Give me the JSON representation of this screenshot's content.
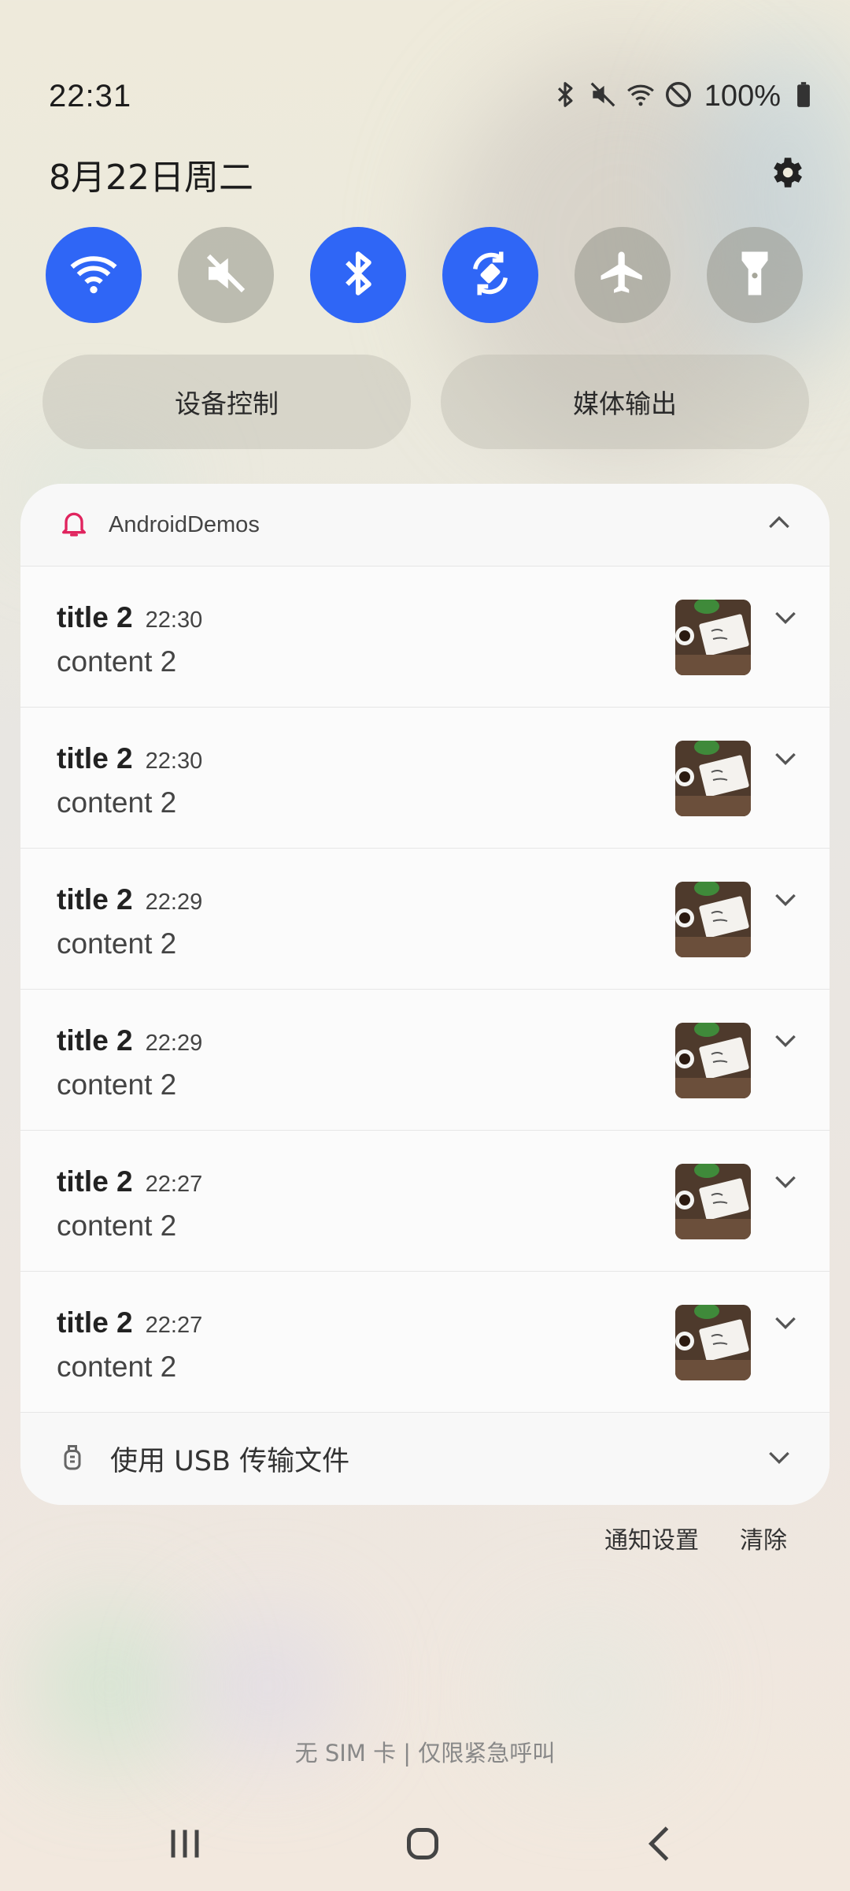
{
  "status_bar": {
    "time": "22:31",
    "battery": "100%",
    "icons": [
      "bluetooth-icon",
      "mute-icon",
      "wifi-icon",
      "do-not-disturb-icon",
      "battery-icon"
    ]
  },
  "header": {
    "date": "8月22日周二",
    "settings_icon": "gear-icon"
  },
  "quick_settings": [
    {
      "name": "wifi",
      "icon": "wifi-icon",
      "state": "on"
    },
    {
      "name": "sound",
      "icon": "mute-icon",
      "state": "off"
    },
    {
      "name": "bluetooth",
      "icon": "bluetooth-icon",
      "state": "on"
    },
    {
      "name": "auto-rotate",
      "icon": "rotate-icon",
      "state": "on"
    },
    {
      "name": "airplane",
      "icon": "airplane-icon",
      "state": "off"
    },
    {
      "name": "flashlight",
      "icon": "flashlight-icon",
      "state": "off"
    }
  ],
  "pills": {
    "device_control": "设备控制",
    "media_output": "媒体输出"
  },
  "notification_group": {
    "app_name": "AndroidDemos",
    "app_icon": "bell-icon",
    "accent": "#e0245e",
    "items": [
      {
        "title": "title 2",
        "time": "22:30",
        "content": "content 2"
      },
      {
        "title": "title 2",
        "time": "22:30",
        "content": "content 2"
      },
      {
        "title": "title 2",
        "time": "22:29",
        "content": "content 2"
      },
      {
        "title": "title 2",
        "time": "22:29",
        "content": "content 2"
      },
      {
        "title": "title 2",
        "time": "22:27",
        "content": "content 2"
      },
      {
        "title": "title 2",
        "time": "22:27",
        "content": "content 2"
      }
    ]
  },
  "usb_notification": {
    "label": "使用 USB 传输文件",
    "icon": "usb-icon"
  },
  "actions": {
    "notification_settings": "通知设置",
    "clear": "清除"
  },
  "sim_status": "无 SIM 卡 | 仅限紧急呼叫",
  "colors": {
    "qs_on": "#2f66f6",
    "qs_off": "#a6a69a"
  }
}
